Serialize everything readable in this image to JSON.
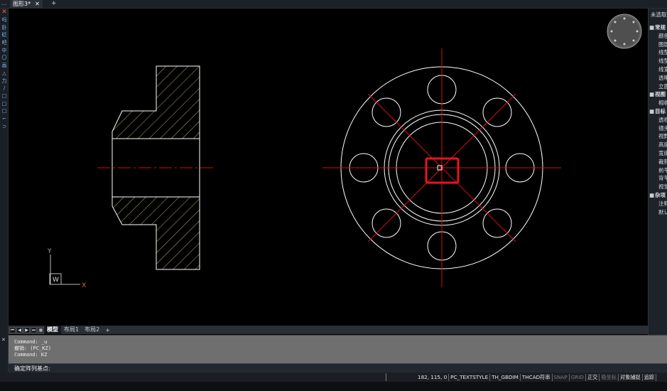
{
  "title_bar": {
    "menu_dots": "...",
    "tab_label": "图形3*",
    "tab_close": "✕",
    "add_tab": "+"
  },
  "left_toolbar": [
    "✕",
    "吗",
    "卧",
    "砭",
    "吧",
    "中",
    "〇",
    "画",
    "△",
    "力",
    "/",
    "□",
    "□",
    "□",
    "⌐",
    "⊃"
  ],
  "layout_tabs": {
    "nav": [
      "⏮",
      "◀",
      "▶",
      "⏭",
      "▦"
    ],
    "tabs": [
      {
        "label": "模型",
        "active": true
      },
      {
        "label": "布局1",
        "active": false
      },
      {
        "label": "布局2",
        "active": false
      }
    ],
    "add": "+"
  },
  "ucs": {
    "x_label": "X",
    "y_label": "Y",
    "w_label": "W"
  },
  "command": {
    "close": "✕",
    "history": [
      "Command: _u",
      "撤销: (PC_KZ)",
      "Command: KZ"
    ],
    "prompt": "确定阵列基点:"
  },
  "status_bar": {
    "coords": "182, 115, 0",
    "items": [
      {
        "label": "PC_TEXTSTYLE",
        "on": true
      },
      {
        "label": "TH_GBDIM",
        "on": true
      },
      {
        "label": "THCAD符串",
        "on": true
      },
      {
        "label": "SNAP",
        "on": false
      },
      {
        "label": "GRID",
        "on": false
      },
      {
        "label": "正交",
        "on": true
      },
      {
        "label": "极坐标",
        "on": false
      },
      {
        "label": "对象捕捉",
        "on": true
      },
      {
        "label": "追踪",
        "on": true
      }
    ]
  },
  "properties": {
    "selection": "未选取",
    "rows": [
      {
        "type": "cat",
        "toggle": "■",
        "label": "常规"
      },
      {
        "type": "item",
        "label": "颜色"
      },
      {
        "type": "item",
        "label": "图层"
      },
      {
        "type": "item",
        "label": "线型"
      },
      {
        "type": "item",
        "label": "线型"
      },
      {
        "type": "item",
        "label": "线宽"
      },
      {
        "type": "item",
        "label": "透明"
      },
      {
        "type": "item",
        "label": "立面"
      },
      {
        "type": "cat",
        "toggle": "■",
        "label": "视图"
      },
      {
        "type": "item",
        "label": "相机"
      },
      {
        "type": "cat",
        "toggle": "■",
        "label": "目标"
      },
      {
        "type": "item",
        "label": "透视"
      },
      {
        "type": "item",
        "label": "镜头"
      },
      {
        "type": "item",
        "label": "视野"
      },
      {
        "type": "item",
        "label": "高度"
      },
      {
        "type": "item",
        "label": "宽度"
      },
      {
        "type": "item",
        "label": "裁剪"
      },
      {
        "type": "item",
        "label": "前平"
      },
      {
        "type": "item",
        "label": "背平"
      },
      {
        "type": "item",
        "label": "视觉"
      },
      {
        "type": "cat",
        "toggle": "■",
        "label": "杂项"
      },
      {
        "type": "item",
        "label": "注释"
      },
      {
        "type": "item",
        "label": "默认"
      }
    ]
  },
  "colors": {
    "accent_red": "#e8151b",
    "hatch": "#b8b264",
    "centerline": "#d01010",
    "geometry": "#ffffff"
  }
}
